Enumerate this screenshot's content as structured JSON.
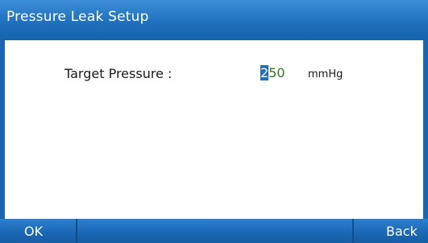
{
  "window": {
    "title": "Pressure Leak Setup"
  },
  "form": {
    "target_pressure_label": "Target Pressure :",
    "target_pressure_cursor_digit": "2",
    "target_pressure_rest": "50",
    "target_pressure_unit": "mmHg"
  },
  "softkeys": {
    "ok_label": "OK",
    "back_label": "Back"
  },
  "colors": {
    "accent": "#1f70bd",
    "value_text": "#2d7d1e",
    "cursor_bg": "#1f6fbf"
  }
}
